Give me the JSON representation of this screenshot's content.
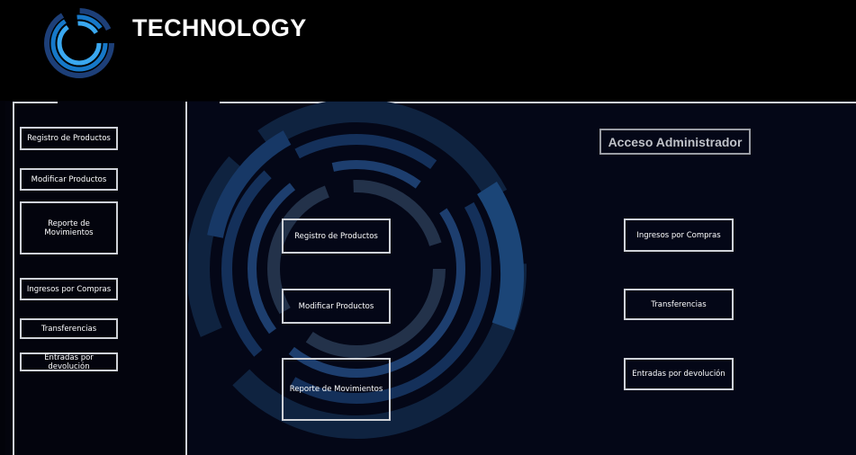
{
  "app": {
    "title": "TECHNOLOGY",
    "logo_icon": "circular-rings-logo-icon"
  },
  "colors": {
    "background": "#02030a",
    "header": "#000000",
    "panel": "#040717",
    "border": "#cfd2d8",
    "ring_blue": "#1a3c6a"
  },
  "sidebar": {
    "items": [
      {
        "label": "Registro de Productos"
      },
      {
        "label": "Modificar Productos"
      },
      {
        "label": "Reporte de Movimientos"
      },
      {
        "label": "Ingresos por Compras"
      },
      {
        "label": "Transferencias"
      },
      {
        "label": "Entradas por devolución"
      }
    ]
  },
  "main": {
    "admin_label": "Acceso Administrador",
    "left_buttons": [
      {
        "label": "Registro de Productos"
      },
      {
        "label": "Modificar Productos"
      },
      {
        "label": "Reporte de Movimientos"
      }
    ],
    "right_buttons": [
      {
        "label": "Ingresos por Compras"
      },
      {
        "label": "Transferencias"
      },
      {
        "label": "Entradas por devolución"
      }
    ]
  }
}
